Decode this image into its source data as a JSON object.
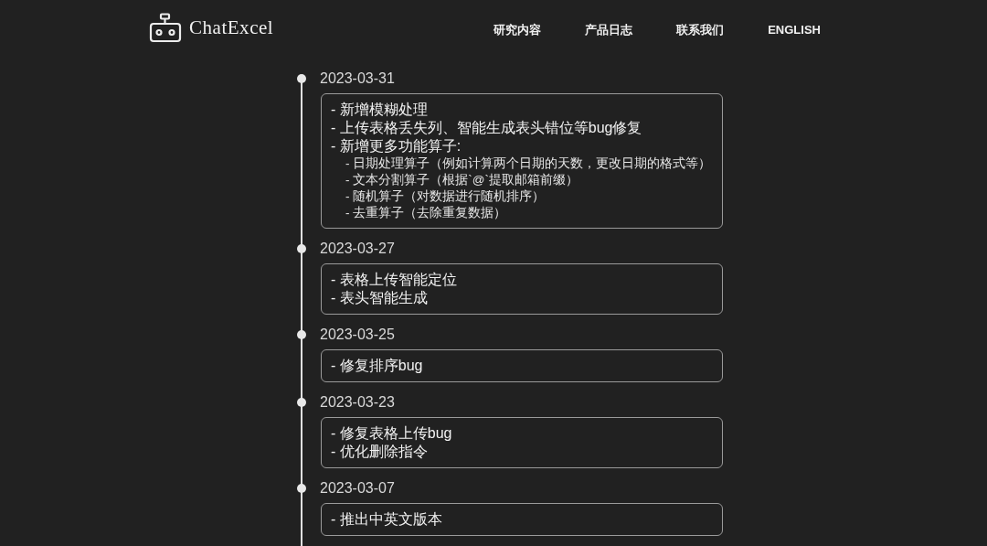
{
  "header": {
    "logo_text": "ChatExcel",
    "nav": [
      {
        "label": "研究内容"
      },
      {
        "label": "产品日志"
      },
      {
        "label": "联系我们"
      },
      {
        "label": "ENGLISH"
      }
    ]
  },
  "timeline": [
    {
      "date": "2023-03-31",
      "lines": [
        {
          "text": "- 新增模糊处理"
        },
        {
          "text": "- 上传表格丢失列、智能生成表头错位等bug修复"
        },
        {
          "text": "- 新增更多功能算子:",
          "children": [
            {
              "text": "- 日期处理算子（例如计算两个日期的天数，更改日期的格式等）"
            },
            {
              "text": "- 文本分割算子（根据`@`提取邮箱前缀）"
            },
            {
              "text": "- 随机算子（对数据进行随机排序）"
            },
            {
              "text": "- 去重算子（去除重复数据）"
            }
          ]
        }
      ]
    },
    {
      "date": "2023-03-27",
      "lines": [
        {
          "text": "- 表格上传智能定位"
        },
        {
          "text": "- 表头智能生成"
        }
      ]
    },
    {
      "date": "2023-03-25",
      "lines": [
        {
          "text": "- 修复排序bug"
        }
      ]
    },
    {
      "date": "2023-03-23",
      "lines": [
        {
          "text": "- 修复表格上传bug"
        },
        {
          "text": "- 优化删除指令"
        }
      ]
    },
    {
      "date": "2023-03-07",
      "lines": [
        {
          "text": "- 推出中英文版本"
        }
      ]
    }
  ]
}
